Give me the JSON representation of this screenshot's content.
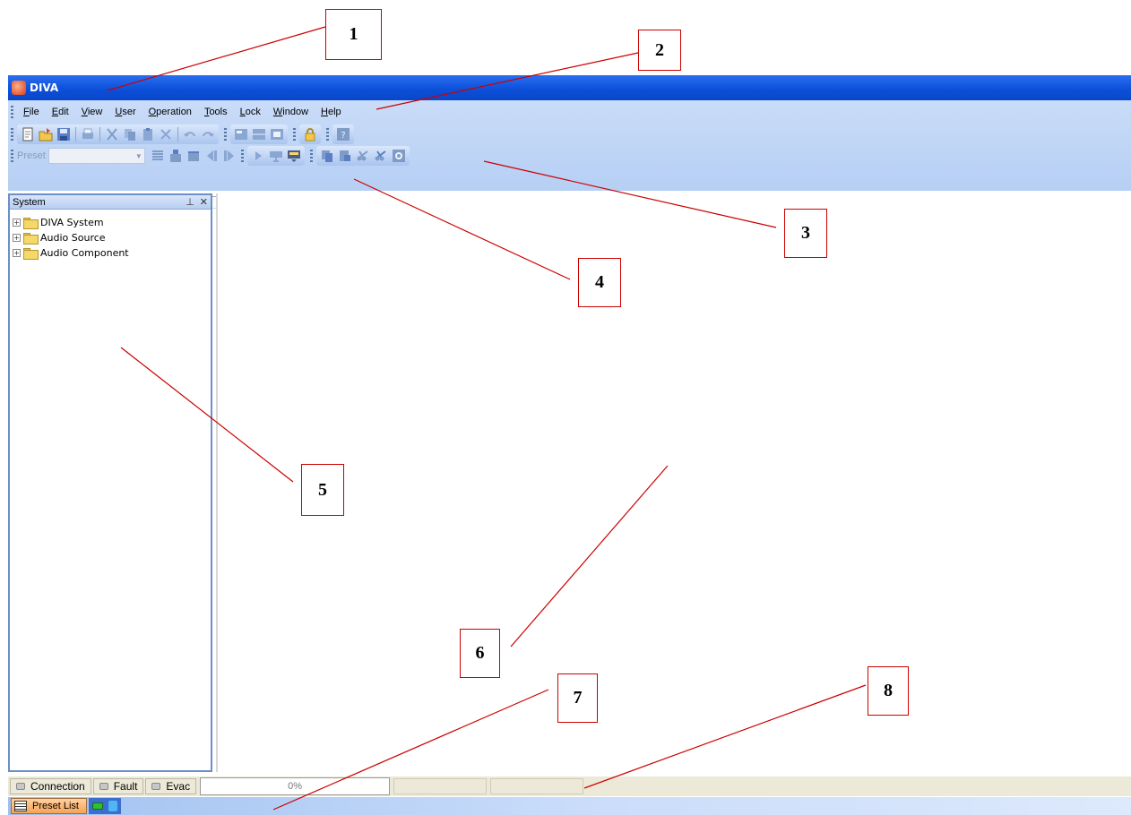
{
  "app": {
    "title": "DIVA",
    "menu": [
      "File",
      "Edit",
      "View",
      "User",
      "Operation",
      "Tools",
      "Lock",
      "Window",
      "Help"
    ],
    "preset_label": "Preset"
  },
  "system_panel": {
    "title": "System",
    "pin_icon": "pin-icon",
    "close_icon": "close-icon",
    "tree": [
      "DIVA System",
      "Audio Source",
      "Audio Component"
    ]
  },
  "statusbar": {
    "connection": "Connection",
    "fault": "Fault",
    "evac": "Evac",
    "progress": "0%"
  },
  "taskbar": {
    "preset_list": "Preset List"
  },
  "callouts": [
    "1",
    "2",
    "3",
    "4",
    "5",
    "6",
    "7",
    "8"
  ],
  "colors": {
    "annotation": "#cc0000",
    "titlebar": "#0b4ed8"
  }
}
